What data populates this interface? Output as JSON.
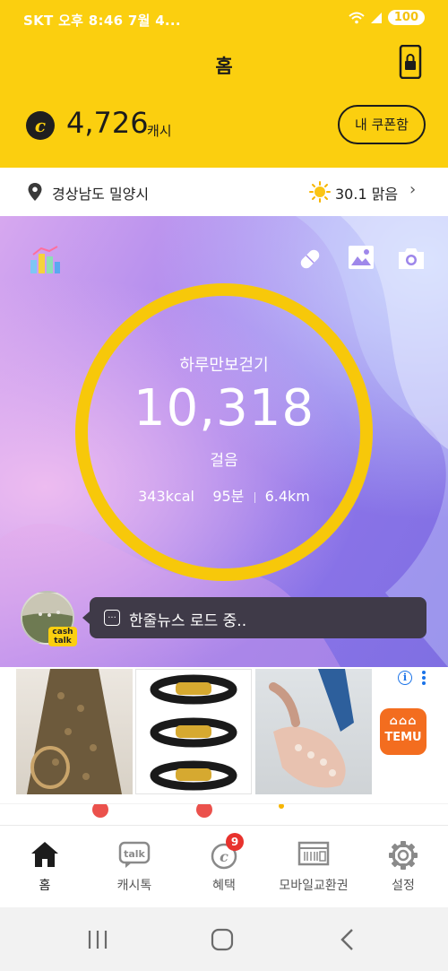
{
  "status_bar": {
    "left": "SKT 오후 8:46  7월 4...",
    "battery": "100"
  },
  "header": {
    "title": "홈",
    "cash_value": "4,726",
    "cash_unit": "캐시",
    "coin_symbol": "c",
    "coupon_button": "내 쿠폰함"
  },
  "location": {
    "region": "경상남도 밀양시",
    "weather": "30.1 맑음"
  },
  "pedometer": {
    "title": "하루만보걷기",
    "steps": "10,318",
    "steps_unit": "걸음",
    "kcal": "343kcal",
    "minutes": "95분",
    "distance": "6.4km",
    "goal_progress": 1.0
  },
  "news": {
    "badge_top": "cash",
    "badge_bottom": "talk",
    "bubble_icon": "...",
    "text": "한줄뉴스 로드 중.."
  },
  "ads": {
    "info_label": "i",
    "brand": "TEMU",
    "brand_symbols": "⌂⌂⌂"
  },
  "bottom_nav": {
    "items": [
      {
        "label": "홈",
        "icon": "home-icon"
      },
      {
        "label": "캐시톡",
        "icon": "talk-icon"
      },
      {
        "label": "혜택",
        "icon": "benefit-icon"
      },
      {
        "label": "모바일교환권",
        "icon": "voucher-icon"
      },
      {
        "label": "설정",
        "icon": "gear-icon"
      }
    ],
    "benefit_badge": "9"
  },
  "colors": {
    "brand_yellow": "#fbcf0f",
    "ring_yellow": "#f7c80a",
    "badge_red": "#e8322d",
    "temu_orange": "#f36d1f"
  }
}
